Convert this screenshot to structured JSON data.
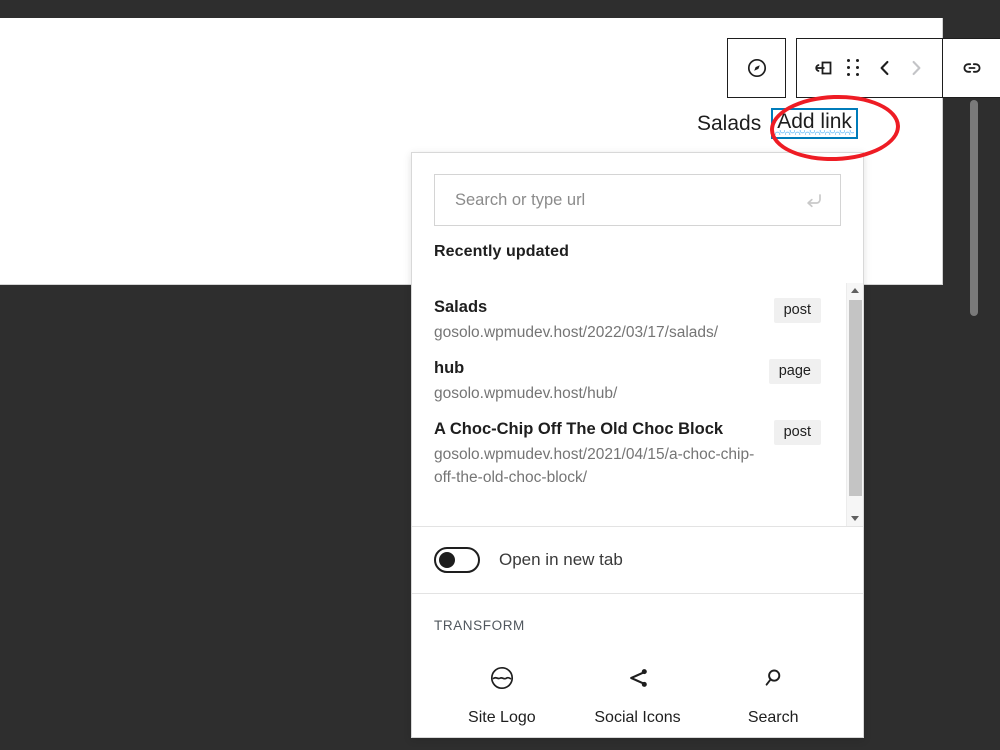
{
  "editor": {
    "paragraph_text": "Salads",
    "link_text": "Add link"
  },
  "toolbar": {
    "navigation_label": "Navigation mode",
    "block_type_label": "Link",
    "drag_label": "Drag",
    "move_up_label": "Move up",
    "move_down_label": "Move down",
    "link_label": "Link"
  },
  "link_popover": {
    "search": {
      "placeholder": "Search or type url",
      "value": "",
      "submit_label": "Submit"
    },
    "results_heading": "Recently updated",
    "results": [
      {
        "title": "Salads",
        "url": "gosolo.wpmudev.host/2022/03/17/salads/",
        "badge": "post"
      },
      {
        "title": "hub",
        "url": "gosolo.wpmudev.host/hub/",
        "badge": "page"
      },
      {
        "title": "A Choc-Chip Off The Old Choc Block",
        "url": "gosolo.wpmudev.host/2021/04/15/a-choc-chip-off-the-old-choc-block/",
        "badge": "post"
      }
    ],
    "new_tab": {
      "label": "Open in new tab",
      "enabled": false
    },
    "transform": {
      "heading": "TRANSFORM",
      "options": [
        {
          "label": "Site Logo",
          "icon": "site-logo-icon"
        },
        {
          "label": "Social Icons",
          "icon": "share-icon"
        },
        {
          "label": "Search",
          "icon": "search-icon"
        }
      ]
    }
  },
  "annotation": {
    "highlight_target": "Add link",
    "color": "#ee1c24"
  },
  "colors": {
    "accent": "#007cba",
    "dark_bg": "#2e2e2e",
    "badge_bg": "#f0f0f0",
    "muted_text": "#757575"
  }
}
